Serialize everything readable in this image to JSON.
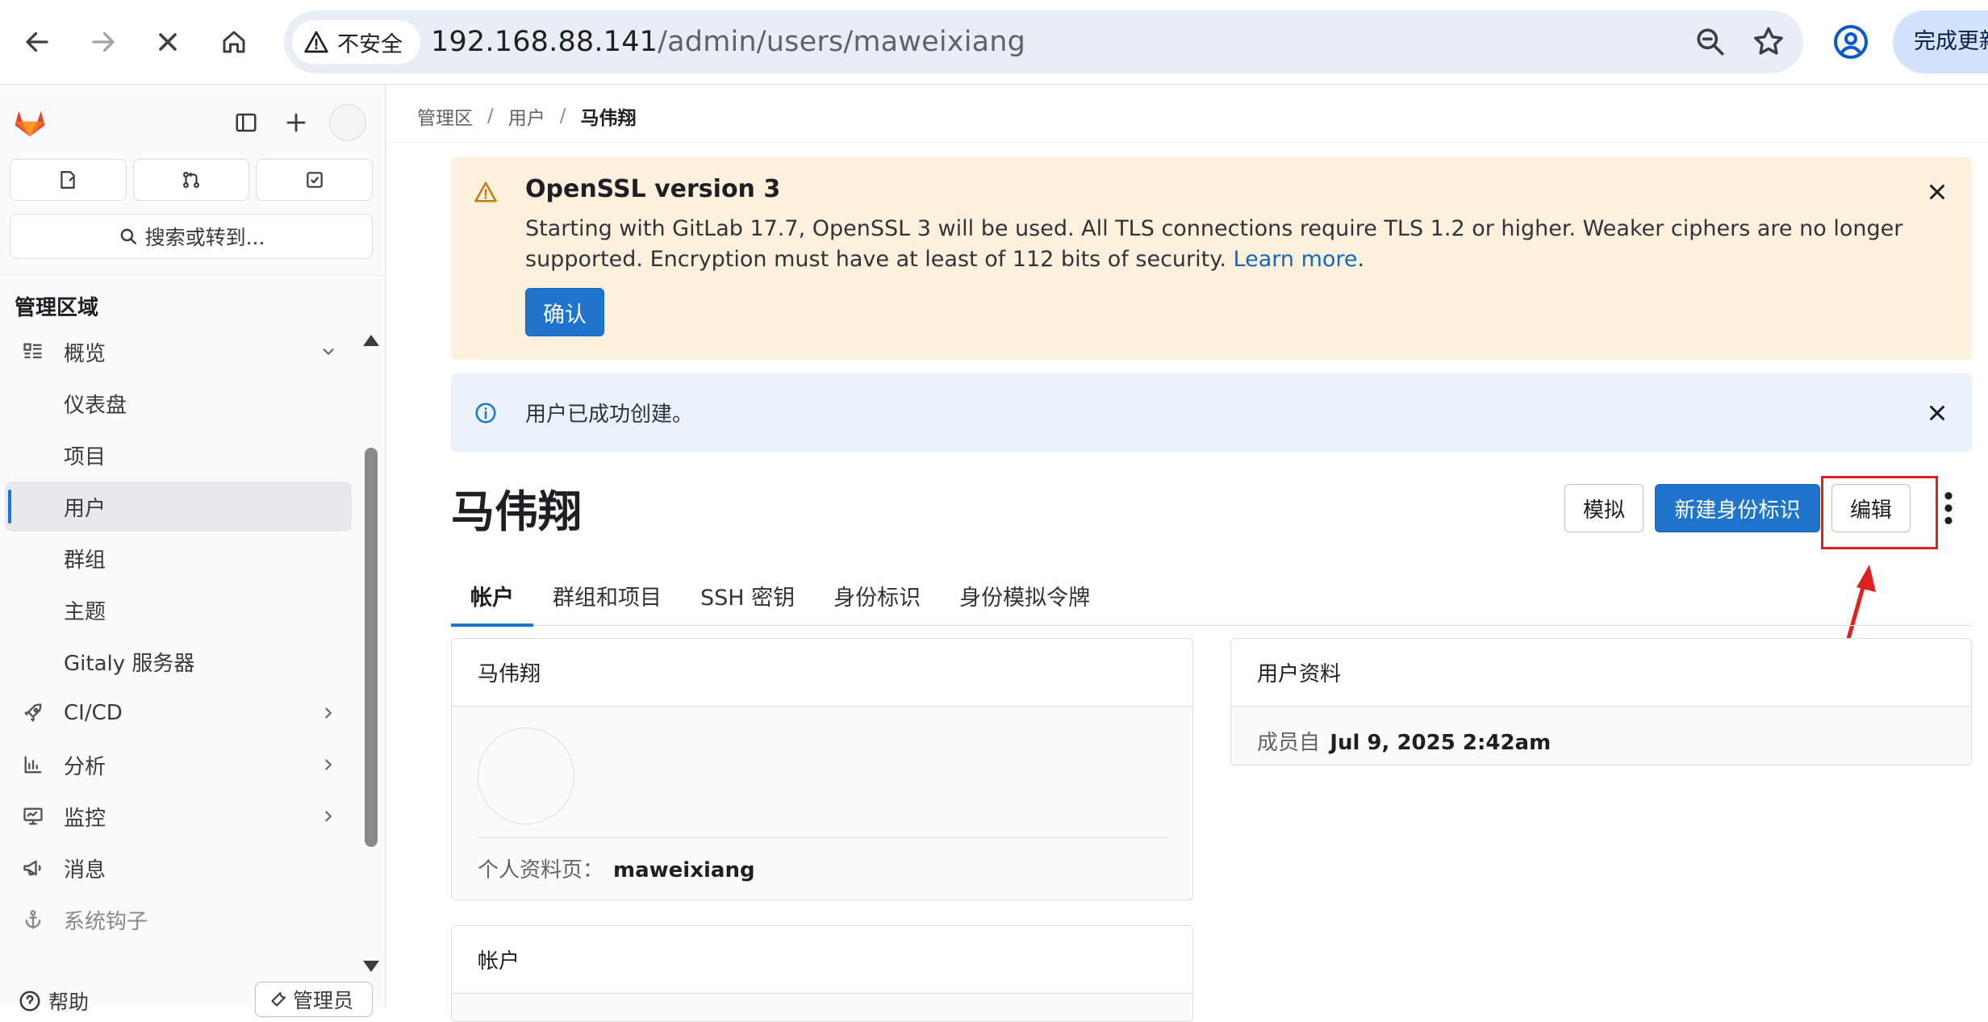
{
  "browser": {
    "security_label": "不安全",
    "url_host": "192.168.88.141",
    "url_path": "/admin/users/maweixiang",
    "update_label": "完成更新"
  },
  "sidebar": {
    "search_label": "搜索或转到...",
    "section_title": "管理区域",
    "items": [
      {
        "label": "概览",
        "icon": "overview-icon",
        "expandable": true,
        "expanded": true
      },
      {
        "label": "仪表盘"
      },
      {
        "label": "项目"
      },
      {
        "label": "用户",
        "active": true
      },
      {
        "label": "群组"
      },
      {
        "label": "主题"
      },
      {
        "label": "Gitaly 服务器"
      },
      {
        "label": "CI/CD",
        "icon": "rocket-icon",
        "expandable": true
      },
      {
        "label": "分析",
        "icon": "chart-icon",
        "expandable": true
      },
      {
        "label": "监控",
        "icon": "monitor-icon",
        "expandable": true
      },
      {
        "label": "消息",
        "icon": "bullhorn-icon"
      },
      {
        "label": "系统钩子",
        "icon": "anchor-icon"
      }
    ],
    "help_label": "帮助",
    "admin_label": "管理员"
  },
  "breadcrumb": [
    "管理区",
    "用户",
    "马伟翔"
  ],
  "warning_alert": {
    "title": "OpenSSL version 3",
    "body": "Starting with GitLab 17.7, OpenSSL 3 will be used. All TLS connections require TLS 1.2 or higher. Weaker ciphers are no longer supported. Encryption must have at least of 112 bits of security.",
    "link_text": "Learn more",
    "confirm_label": "确认"
  },
  "info_alert": {
    "text": "用户已成功创建。"
  },
  "user": {
    "name": "马伟翔",
    "username": "maweixiang",
    "member_since": "Jul 9, 2025 2:42am"
  },
  "actions": {
    "impersonate": "模拟",
    "new_identity": "新建身份标识",
    "edit": "编辑"
  },
  "tabs": [
    "帐户",
    "群组和项目",
    "SSH 密钥",
    "身份标识",
    "身份模拟令牌"
  ],
  "cards": {
    "profile_title": "马伟翔",
    "profile_page_label": "个人资料页：",
    "user_info_title": "用户资料",
    "member_since_label": "成员自",
    "account_title": "帐户"
  },
  "colors": {
    "primary": "#1f75cb",
    "warning_bg": "#fdf1dd",
    "info_bg": "#e9f3fc",
    "annotation_red": "#e02020"
  }
}
